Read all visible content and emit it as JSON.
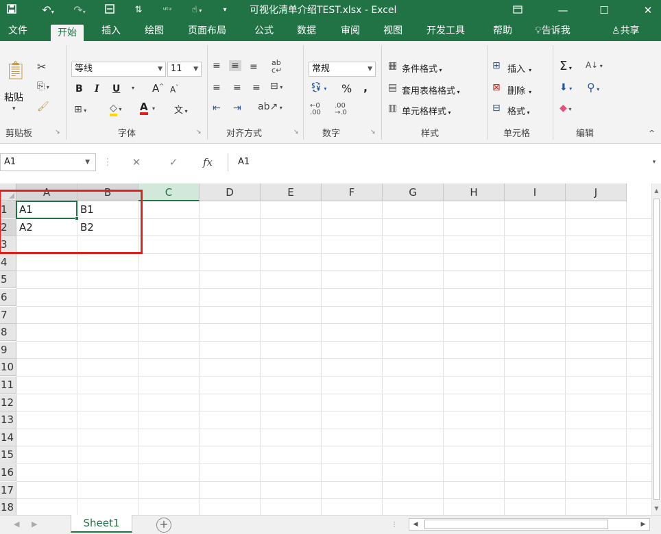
{
  "titlebar": {
    "save_icon": "save-icon",
    "undo_icon": "undo-icon",
    "redo_icon": "redo-icon",
    "title": "可视化清单介绍TEST.xlsx - Excel",
    "restore_icon": "ribbon-display-icon",
    "minimize_icon": "minimize-icon",
    "maximize_icon": "maximize-icon",
    "close_icon": "close-icon",
    "bg_color": "#217346"
  },
  "tabs": {
    "file": "文件",
    "home": "开始",
    "insert": "插入",
    "draw": "绘图",
    "page_layout": "页面布局",
    "formulas": "公式",
    "data": "数据",
    "review": "审阅",
    "view": "视图",
    "developer": "开发工具",
    "help": "帮助",
    "tell_me": "告诉我",
    "share": "共享"
  },
  "ribbon": {
    "clipboard": {
      "paste": "粘贴",
      "label": "剪贴板"
    },
    "font": {
      "font_name": "等线",
      "font_size": "11",
      "bold": "B",
      "italic": "I",
      "underline": "U",
      "grow": "A",
      "shrink": "A",
      "font_color": "A",
      "phonetic": "文",
      "label": "字体"
    },
    "alignment": {
      "label": "对齐方式"
    },
    "number": {
      "format": "常规",
      "percent": "%",
      "comma": ",",
      "label": "数字"
    },
    "styles": {
      "conditional": "条件格式",
      "table": "套用表格格式",
      "cell_styles": "单元格样式",
      "label": "样式"
    },
    "cells": {
      "insert": "插入",
      "delete": "删除",
      "format": "格式",
      "label": "单元格"
    },
    "editing": {
      "sum": "Σ",
      "label": "编辑"
    }
  },
  "formula_bar": {
    "name_box": "A1",
    "cancel": "✕",
    "enter": "✓",
    "fx": "fx",
    "content": "A1"
  },
  "grid": {
    "columns": [
      "A",
      "B",
      "C",
      "D",
      "E",
      "F",
      "G",
      "H",
      "I",
      "J"
    ],
    "rows": [
      "1",
      "2",
      "3",
      "4",
      "5",
      "6",
      "7",
      "8",
      "9",
      "10",
      "11",
      "12",
      "13",
      "14",
      "15",
      "16",
      "17",
      "18"
    ],
    "cells": {
      "A1": "A1",
      "B1": "B1",
      "A2": "A2",
      "B2": "B2"
    },
    "selected_column": "C",
    "active_cell": "A1",
    "highlight_color": "#e0201c",
    "accent_color": "#217346"
  },
  "sheetbar": {
    "sheet_name": "Sheet1",
    "add_sheet": "+"
  }
}
